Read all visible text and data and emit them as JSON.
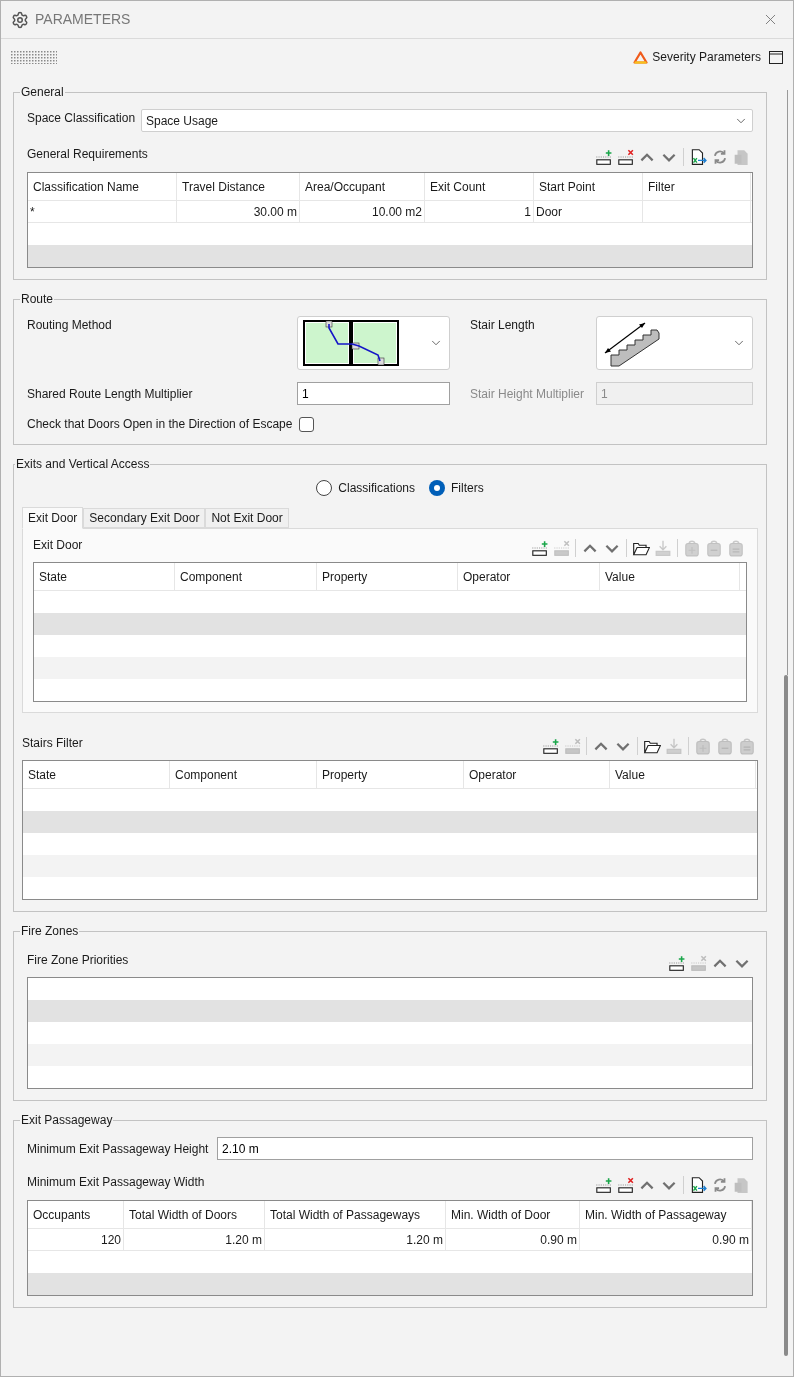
{
  "window": {
    "title": "PARAMETERS"
  },
  "toolbar": {
    "severity_button": "Severity Parameters"
  },
  "general": {
    "title": "General",
    "space_classification": {
      "label": "Space Classification",
      "value": "Space Usage"
    },
    "requirements": {
      "label": "General Requirements",
      "tools": [
        {
          "kind": "add-row",
          "disabled": false
        },
        {
          "kind": "delete-row",
          "disabled": false
        },
        {
          "kind": "up",
          "disabled": false
        },
        {
          "kind": "down",
          "disabled": false
        },
        {
          "kind": "separator"
        },
        {
          "kind": "export",
          "disabled": false
        },
        {
          "kind": "refresh",
          "disabled": false
        },
        {
          "kind": "paste",
          "disabled": true
        }
      ],
      "table": {
        "columns": [
          {
            "label": "Classification Name",
            "kind": "text"
          },
          {
            "label": "Travel Distance",
            "kind": "number"
          },
          {
            "label": "Area/Occupant",
            "kind": "number"
          },
          {
            "label": "Exit Count",
            "kind": "number"
          },
          {
            "label": "Start Point",
            "kind": "text"
          },
          {
            "label": "Filter",
            "kind": "text"
          }
        ],
        "rows": [
          [
            "*",
            "30.00 m",
            "10.00 m2",
            "1",
            "Door"
          ]
        ]
      }
    }
  },
  "route": {
    "title": "Route",
    "routing_method": {
      "label": "Routing Method"
    },
    "stair_length": {
      "label": "Stair Length"
    },
    "shared_multiplier": {
      "label": "Shared Route Length Multiplier",
      "value": "1",
      "disabled": false
    },
    "stair_height_multiplier": {
      "label": "Stair Height Multiplier",
      "value": "1",
      "disabled": true
    },
    "door_check": {
      "label": "Check that Doors Open in the Direction of Escape",
      "checked": false
    }
  },
  "exits": {
    "title": "Exits and Vertical Access",
    "mode_options": [
      {
        "label": "Classifications",
        "selected": false
      },
      {
        "label": "Filters",
        "selected": true
      }
    ],
    "tabs": [
      {
        "label": "Exit Door",
        "selected": true
      },
      {
        "label": "Secondary Exit Door",
        "selected": false
      },
      {
        "label": "Not Exit Door",
        "selected": false
      }
    ],
    "exit_door": {
      "label": "Exit Door",
      "tools": [
        {
          "kind": "add-row",
          "disabled": false
        },
        {
          "kind": "delete-row",
          "disabled": true
        },
        {
          "kind": "separator"
        },
        {
          "kind": "up",
          "disabled": false
        },
        {
          "kind": "down",
          "disabled": false
        },
        {
          "kind": "separator"
        },
        {
          "kind": "open",
          "disabled": false
        },
        {
          "kind": "import",
          "disabled": true
        },
        {
          "kind": "separator"
        },
        {
          "kind": "bag-add",
          "disabled": true
        },
        {
          "kind": "bag-remove",
          "disabled": true
        },
        {
          "kind": "bag-equal",
          "disabled": true
        }
      ],
      "table": {
        "columns": [
          {
            "label": "State"
          },
          {
            "label": "Component"
          },
          {
            "label": "Property"
          },
          {
            "label": "Operator"
          },
          {
            "label": "Value"
          }
        ]
      }
    },
    "stairs_filter": {
      "label": "Stairs Filter",
      "tools": [
        {
          "kind": "add-row",
          "disabled": false
        },
        {
          "kind": "delete-row",
          "disabled": true
        },
        {
          "kind": "separator"
        },
        {
          "kind": "up",
          "disabled": false
        },
        {
          "kind": "down",
          "disabled": false
        },
        {
          "kind": "separator"
        },
        {
          "kind": "open",
          "disabled": false
        },
        {
          "kind": "import",
          "disabled": true
        },
        {
          "kind": "separator"
        },
        {
          "kind": "bag-add",
          "disabled": true
        },
        {
          "kind": "bag-remove",
          "disabled": true
        },
        {
          "kind": "bag-equal",
          "disabled": true
        }
      ],
      "table": {
        "columns": [
          {
            "label": "State"
          },
          {
            "label": "Component"
          },
          {
            "label": "Property"
          },
          {
            "label": "Operator"
          },
          {
            "label": "Value"
          }
        ]
      }
    }
  },
  "fire_zones": {
    "title": "Fire Zones",
    "priorities": {
      "label": "Fire Zone Priorities",
      "tools": [
        {
          "kind": "add-row",
          "disabled": false
        },
        {
          "kind": "delete-row",
          "disabled": true
        },
        {
          "kind": "up",
          "disabled": false
        },
        {
          "kind": "down",
          "disabled": false
        }
      ]
    }
  },
  "exit_passageway": {
    "title": "Exit Passageway",
    "min_height": {
      "label": "Minimum Exit Passageway Height",
      "value": "2.10 m"
    },
    "min_width": {
      "label": "Minimum Exit Passageway Width",
      "tools": [
        {
          "kind": "add-row",
          "disabled": false
        },
        {
          "kind": "delete-row",
          "disabled": false
        },
        {
          "kind": "up",
          "disabled": false
        },
        {
          "kind": "down",
          "disabled": false
        },
        {
          "kind": "separator"
        },
        {
          "kind": "export",
          "disabled": false
        },
        {
          "kind": "refresh",
          "disabled": false
        },
        {
          "kind": "paste",
          "disabled": true
        }
      ],
      "table": {
        "columns": [
          {
            "label": "Occupants",
            "kind": "number"
          },
          {
            "label": "Total Width of Doors",
            "kind": "number"
          },
          {
            "label": "Total Width of Passageways",
            "kind": "number"
          },
          {
            "label": "Min. Width of Door",
            "kind": "number"
          },
          {
            "label": "Min. Width of Passageway",
            "kind": "number"
          }
        ],
        "rows": [
          [
            "120",
            "1.20 m",
            "1.20 m",
            "0.90 m",
            "0.90 m"
          ]
        ]
      }
    }
  }
}
